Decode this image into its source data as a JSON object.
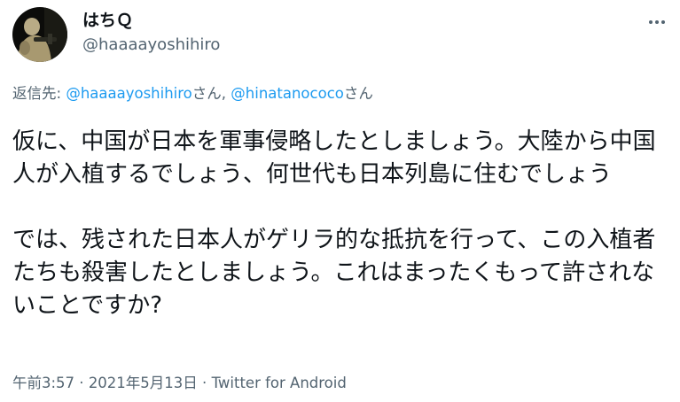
{
  "author": {
    "display_name": "はちＱ",
    "handle": "@haaaayoshihiro",
    "avatar_icon": "profile-photo-icon",
    "more_icon": "more-options-icon"
  },
  "reply": {
    "prefix": "返信先: ",
    "mention1": "@haaaayoshihiro",
    "suffix1": "さん, ",
    "mention2": "@hinatanococo",
    "suffix2": "さん"
  },
  "tweet": {
    "text": "仮に、中国が日本を軍事侵略したとしましょう。大陸から中国人が入植するでしょう、何世代も日本列島に住むでしょう\n\nでは、残された日本人がゲリラ的な抵抗を行って、この入植者たちも殺害したとしましょう。これはまったくもって許されないことですか?"
  },
  "meta": {
    "time": "午前3:57",
    "sep1": " · ",
    "date": "2021年5月13日",
    "sep2": " · ",
    "source": "Twitter for Android"
  },
  "colors": {
    "text": "#0f1419",
    "secondary": "#536471",
    "link": "#1d9bf0"
  }
}
